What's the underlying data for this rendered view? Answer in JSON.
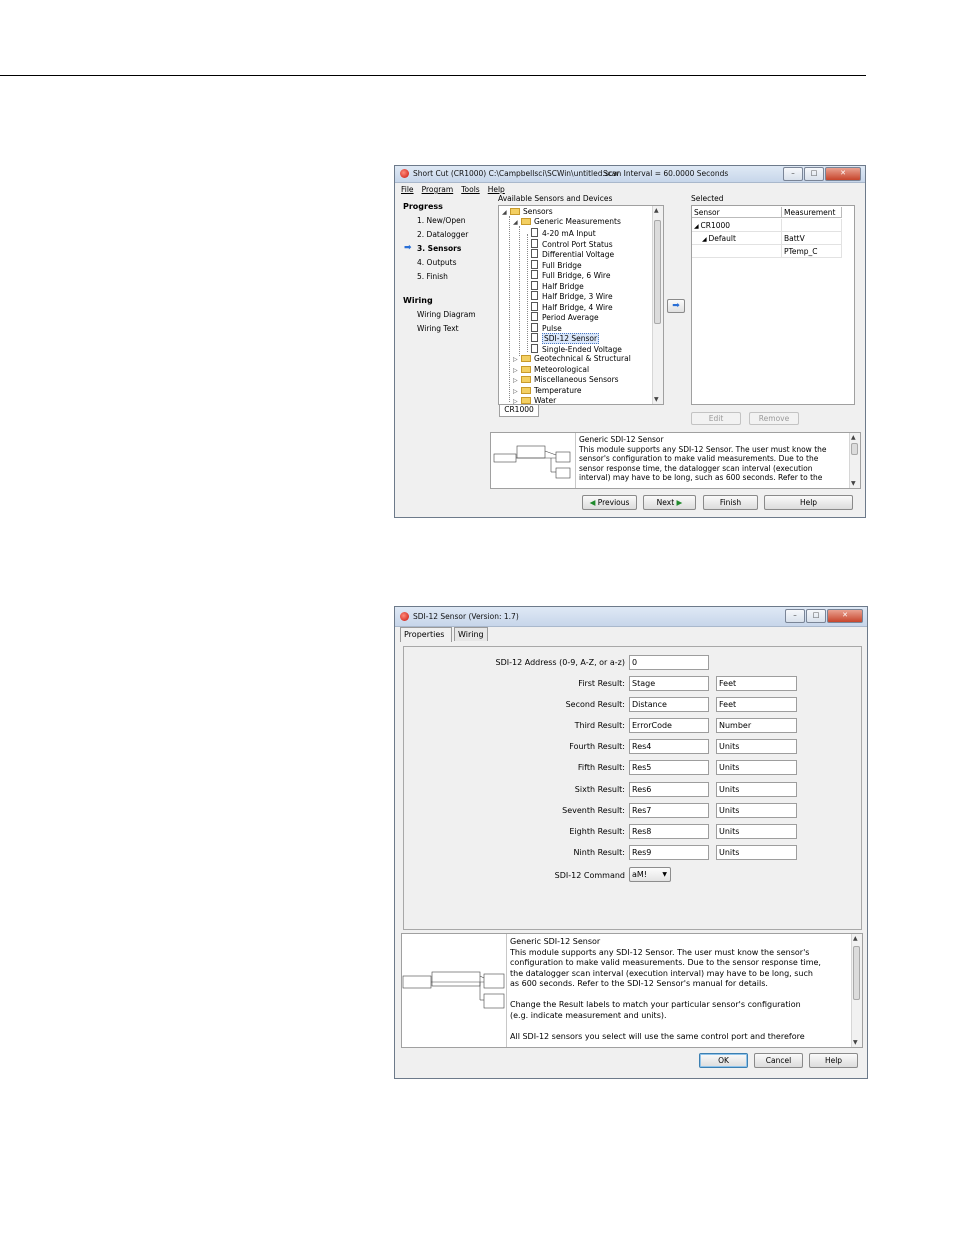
{
  "win1": {
    "title": "Short Cut (CR1000) C:\\Campbellsci\\SCWin\\untitled.scw",
    "scan_interval": "Scan Interval = 60.0000 Seconds",
    "window_controls": [
      "minimize-icon",
      "maximize-icon",
      "close-icon"
    ],
    "menu": [
      "File",
      "Program",
      "Tools",
      "Help"
    ],
    "progress": {
      "header": "Progress",
      "steps": [
        "1. New/Open",
        "2. Datalogger",
        "3. Sensors",
        "4. Outputs",
        "5. Finish"
      ],
      "wiring_header": "Wiring",
      "wiring_items": [
        "Wiring Diagram",
        "Wiring Text"
      ]
    },
    "available_label": "Available Sensors and Devices",
    "tree": {
      "root": "Sensors",
      "generic": "Generic Measurements",
      "generic_items": [
        "4-20 mA Input",
        "Control Port Status",
        "Differential Voltage",
        "Full Bridge",
        "Full Bridge, 6 Wire",
        "Half Bridge",
        "Half Bridge, 3 Wire",
        "Half Bridge, 4 Wire",
        "Period Average",
        "Pulse",
        "SDI-12 Sensor",
        "Single-Ended Voltage"
      ],
      "folders": [
        "Geotechnical & Structural",
        "Meteorological",
        "Miscellaneous Sensors",
        "Temperature",
        "Water"
      ]
    },
    "device_tab": "CR1000",
    "selected_label": "Selected",
    "grid": {
      "headers": [
        "Sensor",
        "Measurement"
      ],
      "rows": [
        {
          "sensor": "CR1000",
          "measurement": ""
        },
        {
          "sensor": "Default",
          "measurement": "BattV"
        },
        {
          "sensor": "",
          "measurement": "PTemp_C"
        }
      ]
    },
    "edit_label": "Edit",
    "remove_label": "Remove",
    "description": {
      "title": "Generic SDI-12 Sensor",
      "lines": [
        "This module supports any SDI-12 Sensor. The user must know the",
        "sensor's configuration to make valid measurements. Due to the",
        "sensor response time, the datalogger scan interval (execution",
        "interval) may have to be long, such as 600 seconds.  Refer to the"
      ]
    },
    "buttons": {
      "previous": "Previous",
      "next": "Next",
      "finish": "Finish",
      "help": "Help"
    }
  },
  "win2": {
    "title": "SDI-12 Sensor (Version: 1.7)",
    "tabs": [
      "Properties",
      "Wiring"
    ],
    "address_label": "SDI-12 Address (0-9, A-Z, or a-z)",
    "address_value": "0",
    "results": [
      {
        "label": "First Result:",
        "name": "Stage",
        "units": "Feet"
      },
      {
        "label": "Second Result:",
        "name": "Distance",
        "units": "Feet"
      },
      {
        "label": "Third Result:",
        "name": "ErrorCode",
        "units": "Number"
      },
      {
        "label": "Fourth Result:",
        "name": "Res4",
        "units": "Units"
      },
      {
        "label": "Fifth Result:",
        "name": "Res5",
        "units": "Units"
      },
      {
        "label": "Sixth Result:",
        "name": "Res6",
        "units": "Units"
      },
      {
        "label": "Seventh Result:",
        "name": "Res7",
        "units": "Units"
      },
      {
        "label": "Eighth Result:",
        "name": "Res8",
        "units": "Units"
      },
      {
        "label": "Ninth Result:",
        "name": "Res9",
        "units": "Units"
      }
    ],
    "command_label": "SDI-12 Command",
    "command_value": "aM!",
    "description": {
      "title": "Generic SDI-12 Sensor",
      "lines": [
        "This module supports any SDI-12 Sensor. The user must know the sensor's",
        "configuration to make valid measurements. Due to the sensor response time,",
        "the datalogger scan interval (execution interval) may have to be long, such",
        "as 600 seconds.  Refer to the SDI-12 Sensor's manual for details.",
        "",
        "Change the Result labels to match your particular sensor's configuration",
        "(e.g. indicate measurement and units).",
        "",
        "All SDI-12 sensors you select will use the same control port and therefore"
      ]
    },
    "buttons": {
      "ok": "OK",
      "cancel": "Cancel",
      "help": "Help"
    }
  }
}
